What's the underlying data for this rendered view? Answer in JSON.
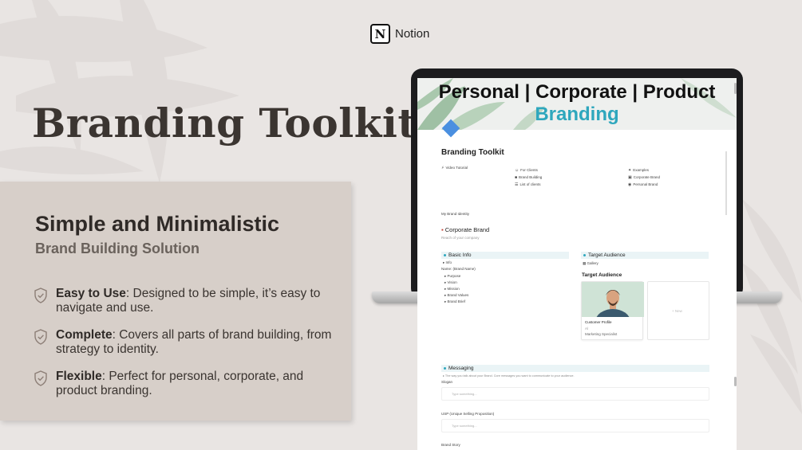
{
  "brand": {
    "name": "Notion",
    "logo_letter": "N"
  },
  "headline": "Branding Toolkit",
  "card": {
    "title": "Simple and Minimalistic",
    "subtitle": "Brand Building Solution",
    "features": [
      {
        "title": "Easy to Use",
        "text": ": Designed to be simple, it’s easy to navigate and use."
      },
      {
        "title": "Complete",
        "text": ": Covers all parts of brand building, from strategy to identity."
      },
      {
        "title": "Flexible",
        "text": ": Perfect for personal, corporate, and product branding."
      }
    ]
  },
  "screen": {
    "cover_line1": "Personal | Corporate | Product",
    "cover_line2": "Branding",
    "page_title": "Branding Toolkit",
    "links_col1": [
      "Video Tutorial"
    ],
    "links_col2": [
      "For Clients",
      "Brand Building",
      "List of clients"
    ],
    "links_col3": [
      "Examples",
      "Corporate Brand",
      "Personal Brand"
    ],
    "identity_label": "My Brand Identity",
    "brand_heading": "Corporate Brand",
    "brand_caption": "Reach of your company",
    "basic_info": {
      "heading": "Basic Info",
      "items": [
        "Info",
        "Name: (Brand Name)",
        "Purpose",
        "Vision",
        "Mission",
        "Brand Values",
        "Brand Brief"
      ]
    },
    "target": {
      "heading": "Target Audience",
      "view": "Gallery",
      "title": "Target Audience",
      "card_title": "Customer Profile",
      "card_line1": "Al",
      "card_line2": "Marketing Specialist",
      "new_label": "+ New"
    },
    "messaging": {
      "heading": "Messaging",
      "caption": "The way you talk about your Brand. Core messages you want to communicate to your audience.",
      "slogan_label": "Slogan",
      "usp_label": "USP (Unique Selling Proposition)",
      "placeholder": "Type something...",
      "story_label": "Brand Story"
    }
  },
  "colors": {
    "background": "#e9e5e3",
    "card": "#d7cfc9",
    "accent_teal": "#2ea7bd",
    "headline": "#3b3531"
  }
}
